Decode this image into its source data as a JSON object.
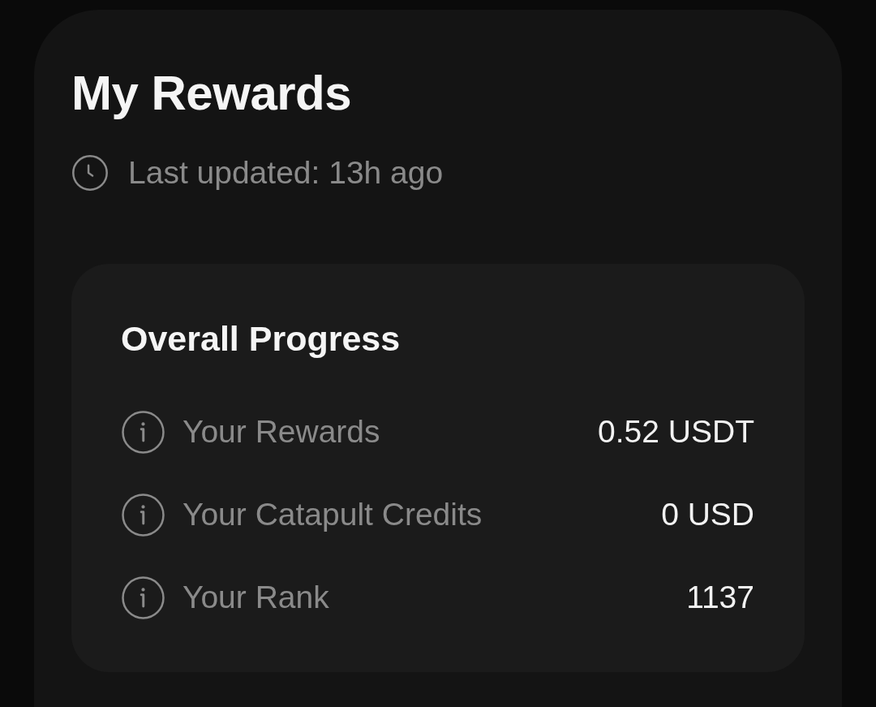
{
  "rewards": {
    "title": "My Rewards",
    "last_updated": "Last updated: 13h ago"
  },
  "progress": {
    "title": "Overall Progress",
    "rows": [
      {
        "label": "Your Rewards",
        "value": "0.52 USDT"
      },
      {
        "label": "Your Catapult Credits",
        "value": "0 USD"
      },
      {
        "label": "Your Rank",
        "value": "1137"
      }
    ]
  }
}
